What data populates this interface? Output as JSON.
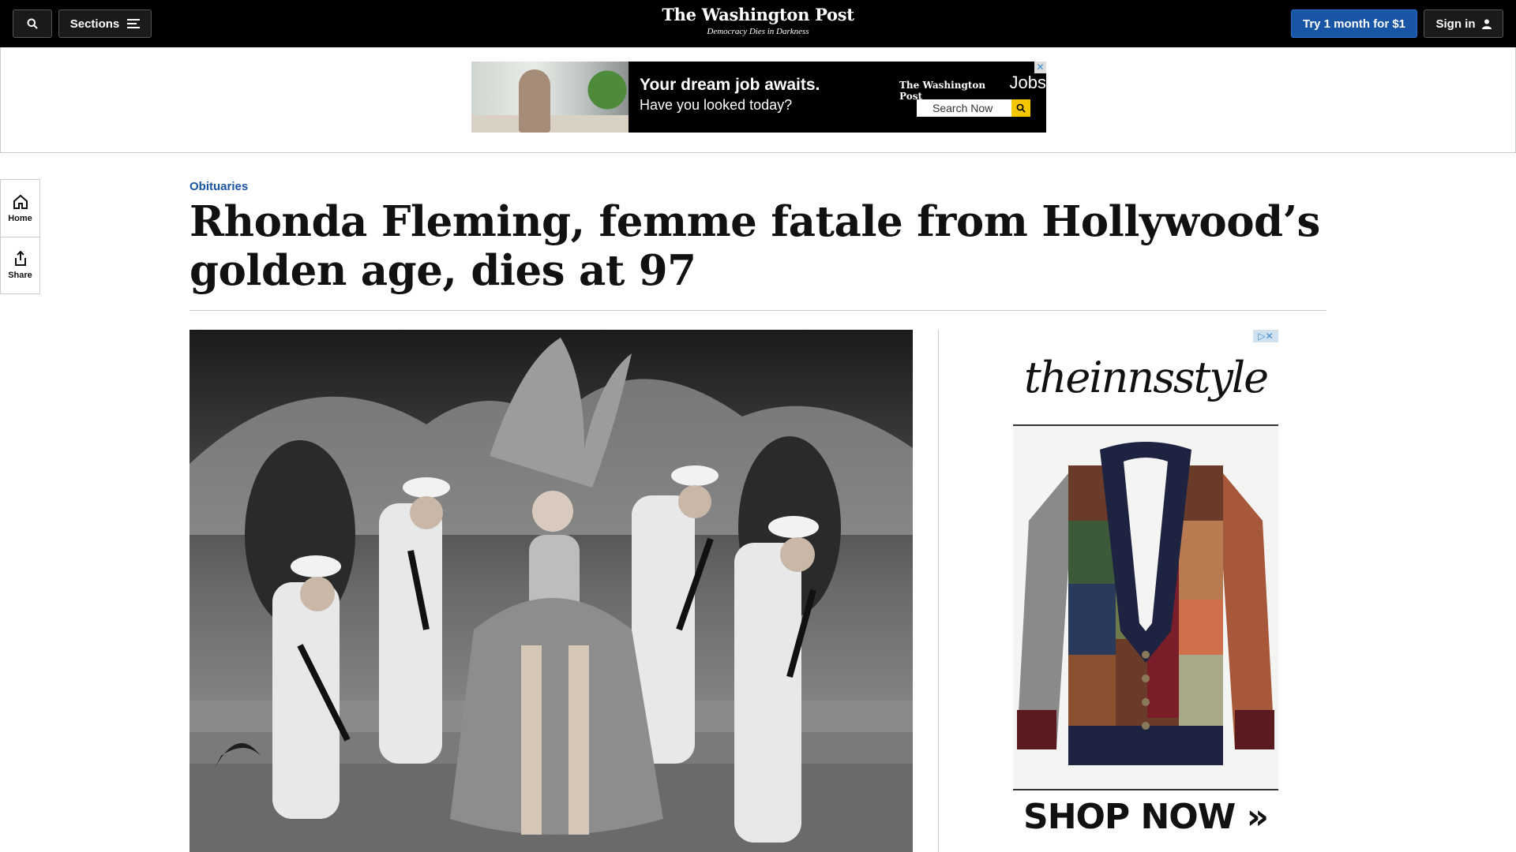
{
  "header": {
    "sections_label": "Sections",
    "logo": "The Washington Post",
    "tagline": "Democracy Dies in Darkness",
    "subscribe_label": "Try 1 month for $1",
    "signin_label": "Sign in"
  },
  "banner_ad": {
    "headline": "Your dream job awaits.",
    "subline": "Have you looked today?",
    "brand_wp": "The Washington Post",
    "brand_jobs": "Jobs",
    "search_label": "Search Now",
    "close": "✕"
  },
  "left_rail": {
    "home_label": "Home",
    "share_label": "Share"
  },
  "article": {
    "kicker": "Obituaries",
    "headline": "Rhonda Fleming, femme fatale from Hollywood’s golden age, dies at 97"
  },
  "side_ad": {
    "logo_text": "theinnsstyle",
    "cta": "SHOP NOW »",
    "adchoices": "▷✕"
  },
  "icons": {
    "search": "search-icon",
    "menu": "menu-icon",
    "user": "user-icon",
    "home": "home-icon",
    "share": "share-icon"
  },
  "colors": {
    "topbar": "#000000",
    "accent_blue": "#1955a5",
    "ad_yellow": "#f6c700"
  }
}
